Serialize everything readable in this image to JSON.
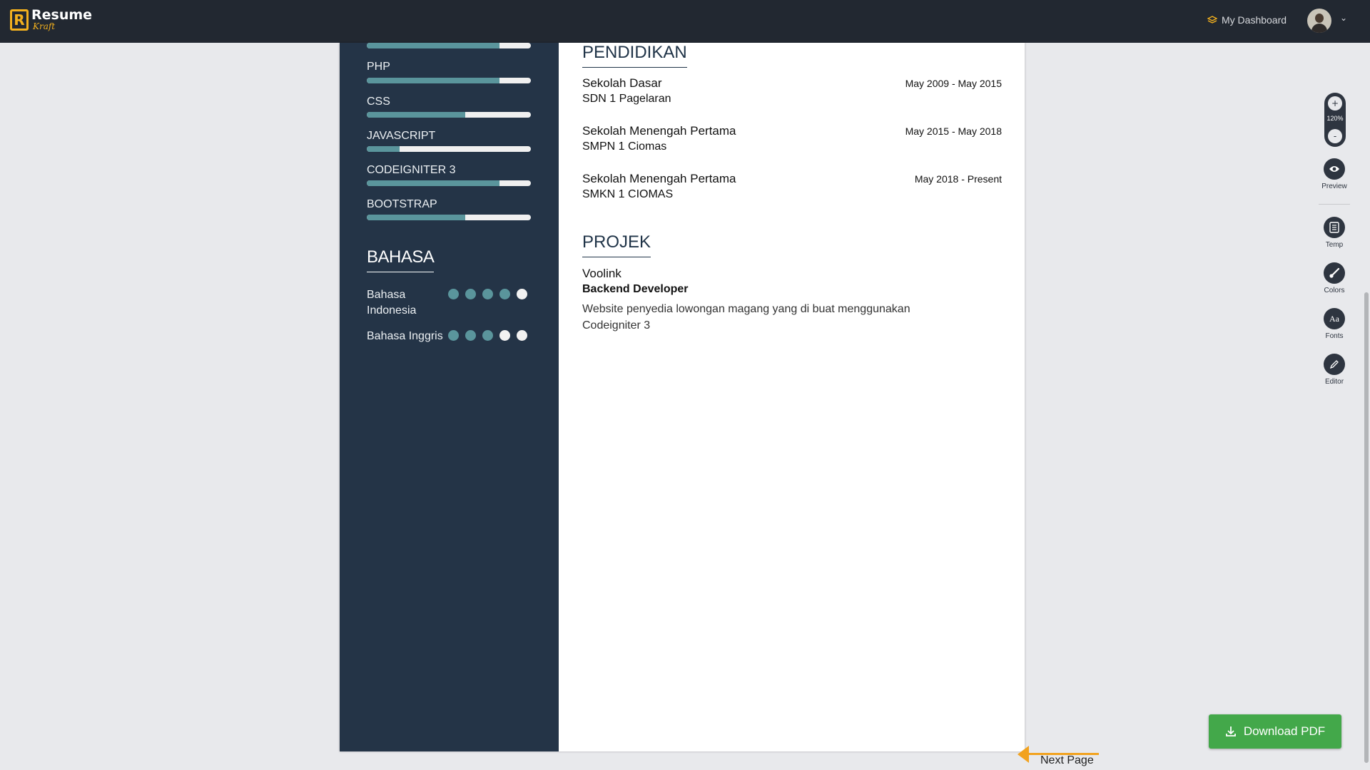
{
  "app": {
    "logo_title": "Resume",
    "logo_sub": "Kraft",
    "logo_letter": "R",
    "nav_dashboard": "My Dashboard"
  },
  "resume": {
    "skills": [
      {
        "label": "",
        "level": 0.81
      },
      {
        "label": "PHP",
        "level": 0.81
      },
      {
        "label": "CSS",
        "level": 0.6
      },
      {
        "label": "JAVASCRIPT",
        "level": 0.2
      },
      {
        "label": "CODEIGNITER 3",
        "level": 0.81
      },
      {
        "label": "BOOTSTRAP",
        "level": 0.6
      }
    ],
    "languages_heading": "BAHASA",
    "languages": [
      {
        "name": "Bahasa Indonesia",
        "rating": 4,
        "max": 5
      },
      {
        "name": "Bahasa Inggris",
        "rating": 3,
        "max": 5
      }
    ],
    "education_heading": "PENDIDIKAN",
    "education": [
      {
        "title": "Sekolah Dasar",
        "school": "SDN 1 Pagelaran",
        "dates": "May 2009 - May 2015"
      },
      {
        "title": "Sekolah Menengah Pertama",
        "school": "SMPN 1 Ciomas",
        "dates": "May 2015 - May 2018"
      },
      {
        "title": "Sekolah Menengah Pertama",
        "school": "SMKN 1 CIOMAS",
        "dates": "May 2018 - Present"
      }
    ],
    "projects_heading": "PROJEK",
    "project": {
      "name": "Voolink",
      "role": "Backend Developer",
      "description": "Website penyedia lowongan magang yang di buat menggunakan Codeigniter 3"
    }
  },
  "toolbar": {
    "zoom_in": "+",
    "zoom_level": "120%",
    "zoom_out": "-",
    "preview": "Preview",
    "temp": "Temp",
    "colors": "Colors",
    "fonts": "Fonts",
    "editor": "Editor"
  },
  "actions": {
    "download": "Download PDF",
    "next_page": "Next Page"
  },
  "colors": {
    "sidebar": "#243447",
    "accent": "#5a959c",
    "brand": "#f2b01e",
    "download": "#43a84a"
  }
}
